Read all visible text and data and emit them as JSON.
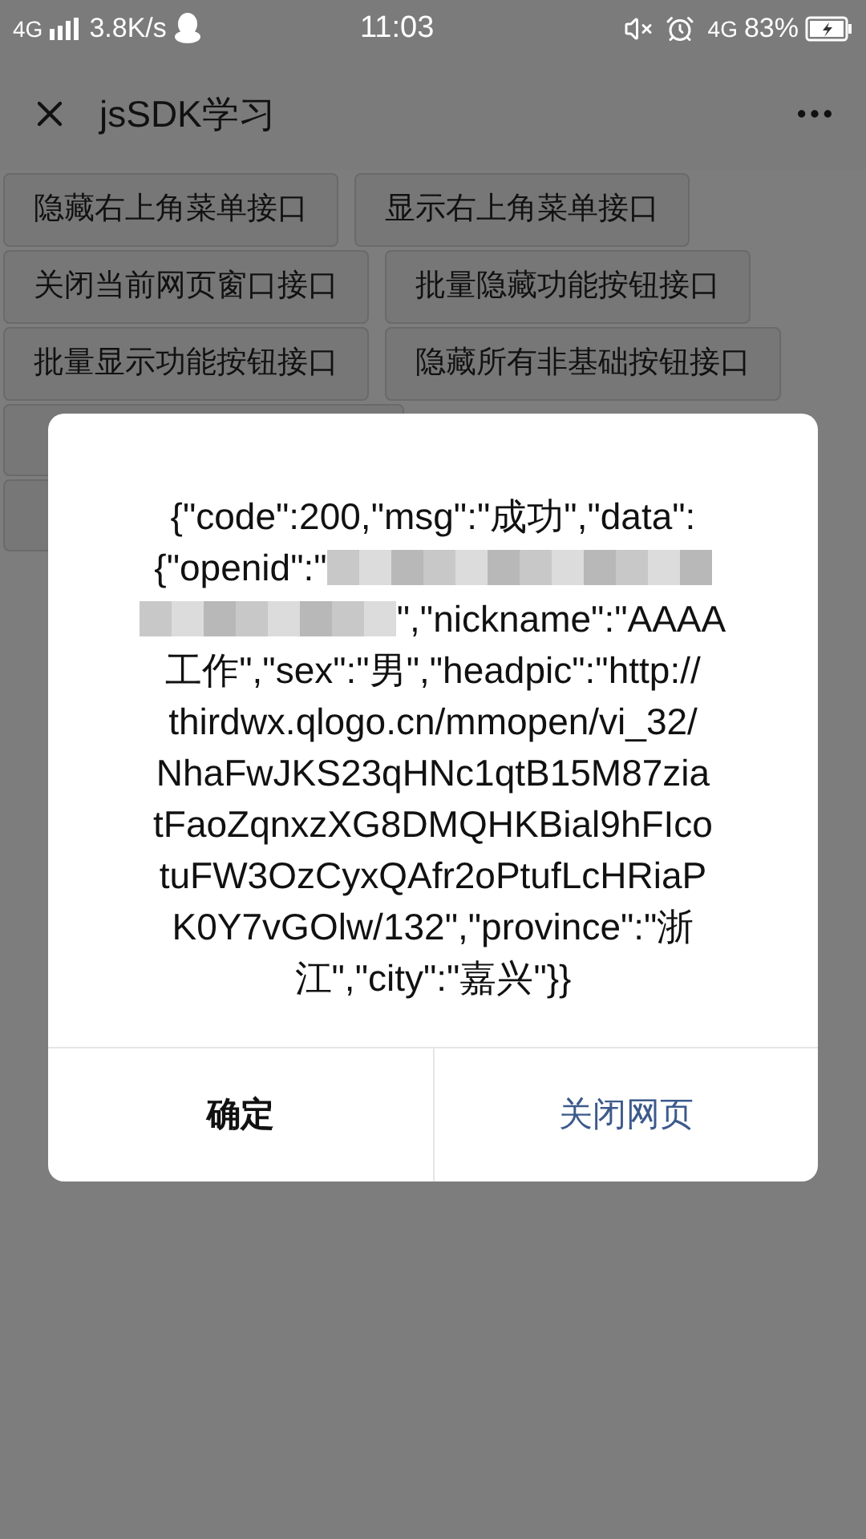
{
  "status_bar": {
    "network": "4G",
    "speed": "3.8K/s",
    "time": "11:03",
    "data_network": "4G",
    "battery": "83%"
  },
  "header": {
    "title": "jsSDK学习"
  },
  "buttons": [
    {
      "kind": "full",
      "label": "隐藏右上角菜单接口"
    },
    {
      "kind": "full",
      "label": "显示右上角菜单接口"
    },
    {
      "kind": "full",
      "label": "关闭当前网页窗口接口"
    },
    {
      "kind": "full",
      "label": "批量隐藏功能按钮接口"
    },
    {
      "kind": "full",
      "label": "批量显示功能按钮接口"
    },
    {
      "kind": "full",
      "label": "隐藏所有非基础按钮接口"
    },
    {
      "kind": "covered"
    },
    {
      "kind": "covered"
    }
  ],
  "dialog": {
    "lines": [
      [
        {
          "kind": "text",
          "text": "{\"code\":200,\"msg\":\"成功\",\"data\":"
        }
      ],
      [
        {
          "kind": "text",
          "text": "{\"openid\":\""
        },
        {
          "kind": "blur"
        }
      ],
      [
        {
          "kind": "blur"
        },
        {
          "kind": "text",
          "text": "\",\"nickname\":\"AAAA"
        }
      ],
      [
        {
          "kind": "text",
          "text": "工作\",\"sex\":\"男\",\"headpic\":\"http://"
        }
      ],
      [
        {
          "kind": "text",
          "text": "thirdwx.qlogo.cn/mmopen/vi_32/"
        }
      ],
      [
        {
          "kind": "text",
          "text": "NhaFwJKS23qHNc1qtB15M87zia"
        }
      ],
      [
        {
          "kind": "text",
          "text": "tFaoZqnxzXG8DMQHKBial9hFIco"
        }
      ],
      [
        {
          "kind": "text",
          "text": "tuFW3OzCyxQAfr2oPtufLcHRiaP"
        }
      ],
      [
        {
          "kind": "text",
          "text": "K0Y7vGOlw/132\",\"province\":\"浙"
        }
      ],
      [
        {
          "kind": "text",
          "text": "江\",\"city\":\"嘉兴\"}}"
        }
      ]
    ],
    "confirm": "确定",
    "close_page": "关闭网页"
  }
}
